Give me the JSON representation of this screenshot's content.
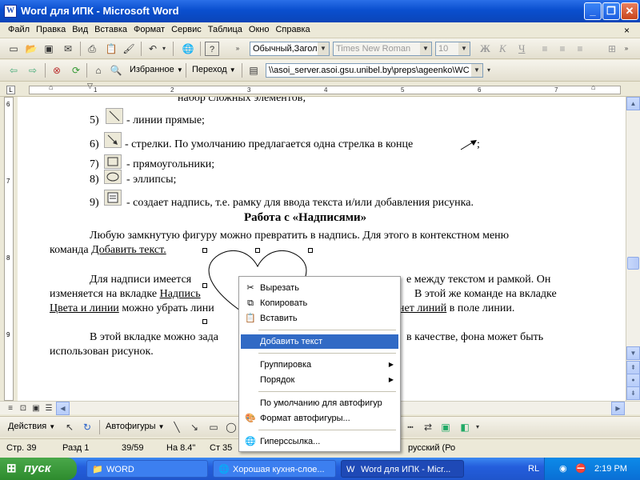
{
  "window": {
    "title": "Word для  ИПК - Microsoft Word",
    "app_icon": "W"
  },
  "menubar": {
    "items": [
      "Файл",
      "Правка",
      "Вид",
      "Вставка",
      "Формат",
      "Сервис",
      "Таблица",
      "Окно",
      "Справка"
    ],
    "close_doc": "×"
  },
  "toolbar_standard": {
    "style_value": "Обычный,Загол",
    "font_value": "Times New Roman",
    "size_value": "10",
    "bold": "Ж",
    "italic": "К",
    "underline": "Ч"
  },
  "toolbar_web": {
    "favorites_label": "Избранное",
    "goto_label": "Переход",
    "address": "\\\\asoi_server.asoi.gsu.unibel.by\\preps\\ageenko\\WC"
  },
  "ruler": {
    "hmarks": [
      "1",
      "2",
      "3",
      "4",
      "5",
      "6",
      "7"
    ],
    "vmarks": [
      "6",
      "7",
      "8",
      "9"
    ]
  },
  "document": {
    "l0": "набор сложных элементов;",
    "n5": "5)",
    "l5": "- линии прямые;",
    "n6": "6)",
    "l6": "- стрелки. По умолчанию предлагается одна стрелка в конце",
    "l6end": ";",
    "n7": "7)",
    "l7": "- прямоугольники;",
    "n8": "8)",
    "l8": "- эллипсы;",
    "n9": "9)",
    "l9": "- создает надпись, т.е. рамку для ввода текста и/или добавления рисунка.",
    "heading": "Работа с «Надписями»",
    "p1a": "Любую замкнутую фигуру можно превратить в надпись. Для этого в контекстном меню",
    "p1b_pre": "команда ",
    "p1b_link": "Добавить текст.",
    "p2a_left": "Для надписи имеется",
    "p2a_right": "е между текстом и рамкой. Он",
    "p2b_left": "изменяется на вкладке",
    "p2b_link": "Надпись",
    "p2b_right": "В этой же команде на вкладке",
    "p2c_link1": "Цвета и линии",
    "p2c_mid": " можно убрать лини",
    "p2c_link2": "нет линий",
    "p2c_right": " в поле линии.",
    "p3a_left": "В этой вкладке можно зада",
    "p3a_right": "в качестве, фона может быть",
    "p3b": "использован рисунок."
  },
  "context_menu": {
    "items": [
      {
        "label": "Вырезать",
        "icon": "scissors-icon"
      },
      {
        "label": "Копировать",
        "icon": "copy-icon"
      },
      {
        "label": "Вставить",
        "icon": "paste-icon"
      },
      {
        "label": "Добавить текст",
        "selected": true
      },
      {
        "label": "Группировка",
        "submenu": true
      },
      {
        "label": "Порядок",
        "submenu": true
      },
      {
        "label": "По умолчанию для автофигур"
      },
      {
        "label": "Формат автофигуры...",
        "icon": "format-icon"
      },
      {
        "label": "Гиперссылка...",
        "icon": "hyperlink-icon"
      }
    ]
  },
  "drawbar": {
    "actions_label": "Действия",
    "autoshapes_label": "Автофигуры"
  },
  "status": {
    "page": "Стр. 39",
    "section": "Разд 1",
    "pages": "39/59",
    "at": "На 8.4\"",
    "line": "Ст 35",
    "lang": "русский (Ро"
  },
  "taskbar": {
    "start_label": "пуск",
    "tasks": [
      "WORD",
      "Хорошая кухня-слое...",
      "Word для  ИПК - Micr..."
    ],
    "lang": "RL",
    "clock": "2:19 PM"
  },
  "colors": {
    "selection": "#316ac5",
    "titlebar": "#0a4fcf",
    "taskbar": "#245edc",
    "start": "#3a9a3a"
  }
}
